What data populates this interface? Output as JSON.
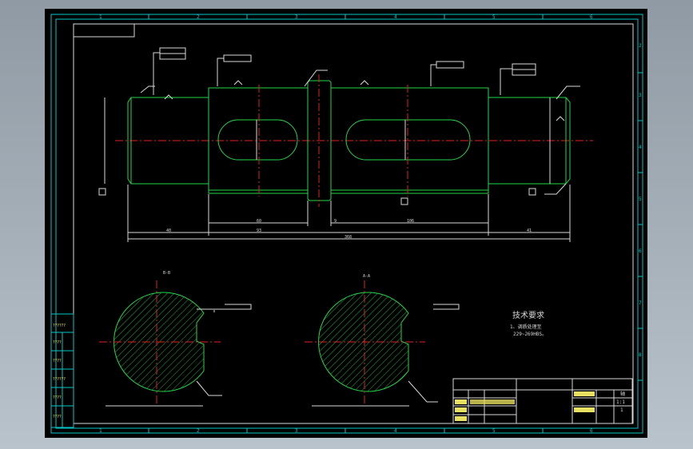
{
  "drawing": {
    "colors": {
      "background": "#000000",
      "part_outline": "#22d64a",
      "dimension": "#d8d8d8",
      "frame": "#00c8c8",
      "center_line": "#e02020"
    },
    "zone_top": [
      "1",
      "2",
      "3",
      "4",
      "5",
      "6"
    ],
    "zone_bottom": [
      "1",
      "2",
      "3",
      "4",
      "5",
      "6"
    ],
    "zone_right": [
      "2",
      "3",
      "4",
      "5",
      "6",
      "7",
      "8"
    ],
    "left_panel": [
      "??????",
      "????",
      "????",
      "??????",
      "????",
      "????"
    ],
    "tech_req": {
      "title": "技术要求",
      "line1": "1、调质处理至",
      "line2": "229~269HBS。"
    },
    "views": {
      "section_a": "B-B",
      "section_b": "A-A"
    },
    "dims": {
      "overall": "368",
      "d_left": "40",
      "d_mid": "93",
      "d_right": "41",
      "d_a": "60",
      "d_b": "106",
      "d_c": "9"
    },
    "title_block": {
      "drawing_label": "轴",
      "scale": "1:1",
      "sheet": "1"
    }
  }
}
